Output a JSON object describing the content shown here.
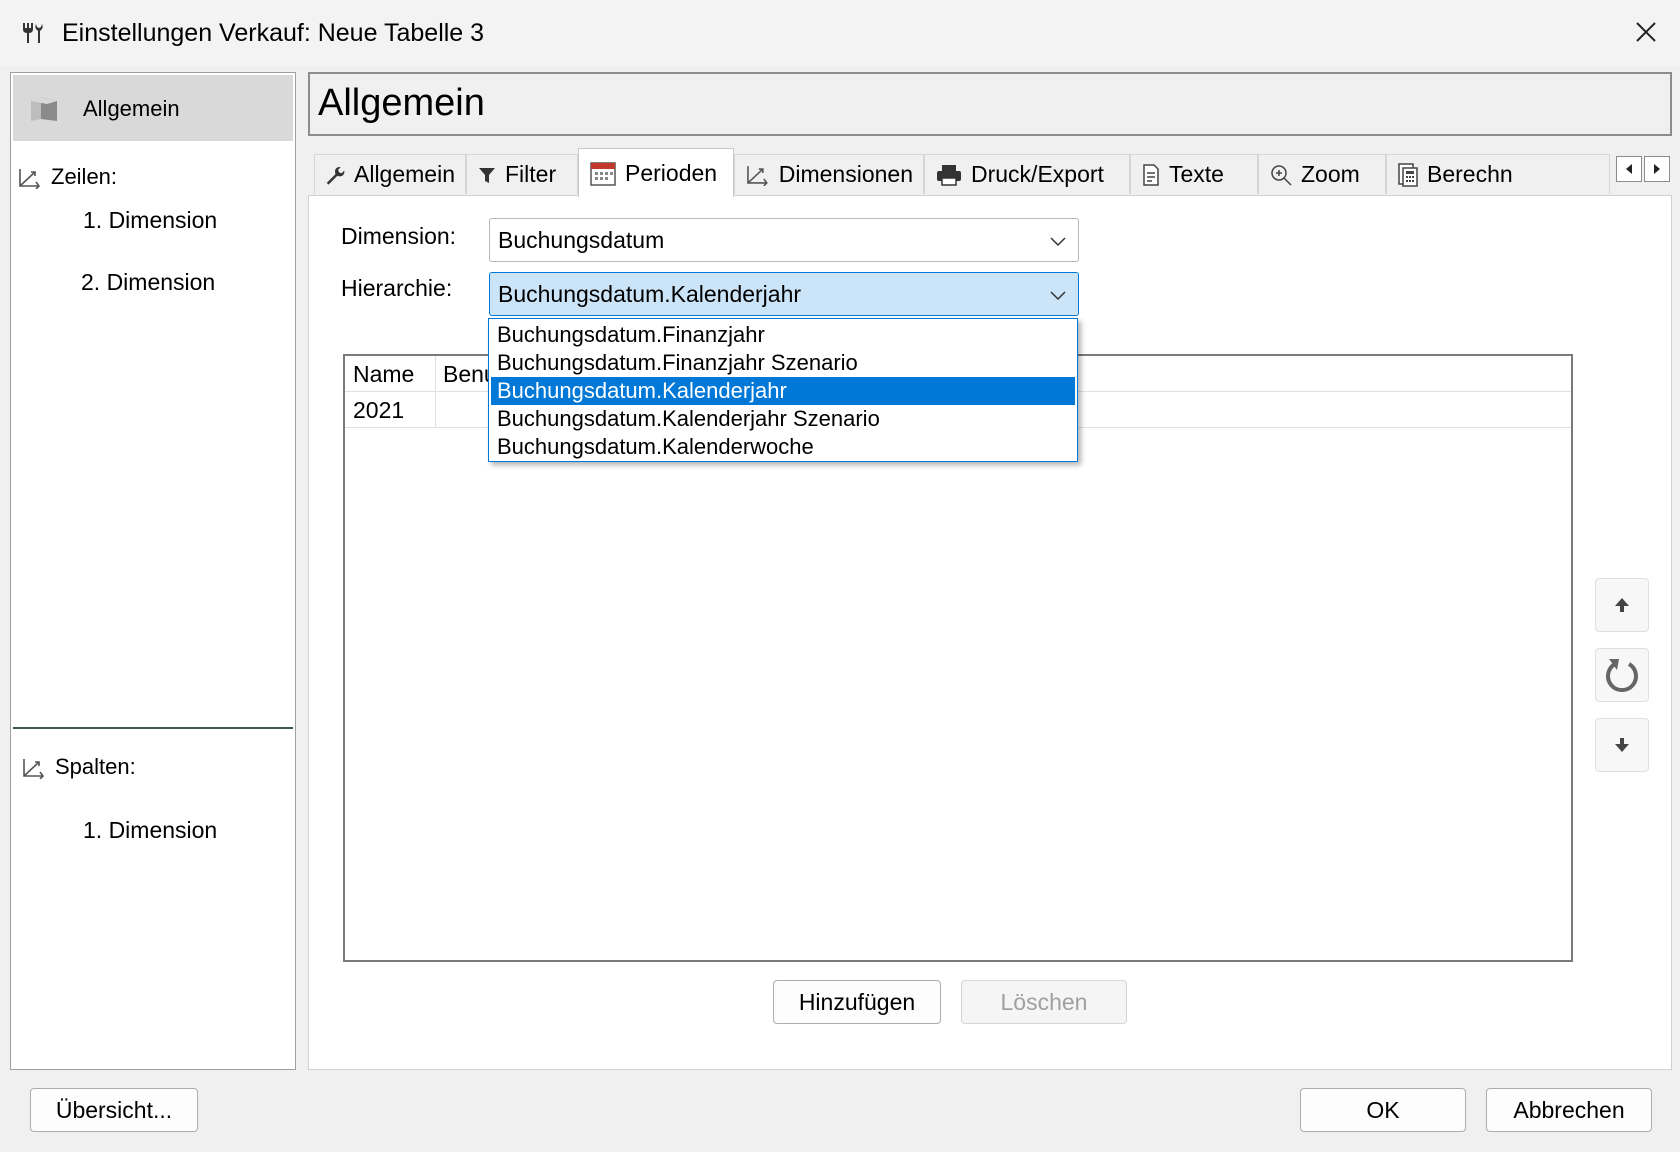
{
  "window": {
    "title": "Einstellungen Verkauf: Neue Tabelle 3",
    "close_symbol": "✕"
  },
  "sidebar": {
    "top_item": "Allgemein",
    "rows_label": "Zeilen:",
    "rows_items": [
      "1. Dimension",
      "2. Dimension"
    ],
    "columns_label": "Spalten:",
    "columns_items": [
      "1. Dimension"
    ]
  },
  "content": {
    "title": "Allgemein"
  },
  "tabs": [
    {
      "label": "Allgemein",
      "icon": "wrench-icon"
    },
    {
      "label": "Filter",
      "icon": "filter-icon"
    },
    {
      "label": "Perioden",
      "icon": "calendar-icon",
      "active": true
    },
    {
      "label": "Dimensionen",
      "icon": "axes-icon"
    },
    {
      "label": "Druck/Export",
      "icon": "printer-icon"
    },
    {
      "label": "Texte",
      "icon": "document-icon"
    },
    {
      "label": "Zoom",
      "icon": "zoom-icon"
    },
    {
      "label": "Berechn",
      "icon": "calculator-icon"
    }
  ],
  "form": {
    "dimension_label": "Dimension:",
    "dimension_value": "Buchungsdatum",
    "hierarchy_label": "Hierarchie:",
    "hierarchy_value": "Buchungsdatum.Kalenderjahr"
  },
  "dropdown": {
    "options": [
      "Buchungsdatum.Finanzjahr",
      "Buchungsdatum.Finanzjahr Szenario",
      "Buchungsdatum.Kalenderjahr",
      "Buchungsdatum.Kalenderjahr Szenario",
      "Buchungsdatum.Kalenderwoche"
    ],
    "selected": "Buchungsdatum.Kalenderjahr"
  },
  "grid": {
    "columns": [
      "Name",
      "Benu"
    ],
    "rows": [
      [
        "2021",
        ""
      ]
    ]
  },
  "buttons": {
    "add": "Hinzufügen",
    "delete": "Löschen",
    "overview": "Übersicht...",
    "ok": "OK",
    "cancel": "Abbrechen"
  },
  "colors": {
    "accent": "#0078d7",
    "focus_bg": "#cce4f7"
  }
}
